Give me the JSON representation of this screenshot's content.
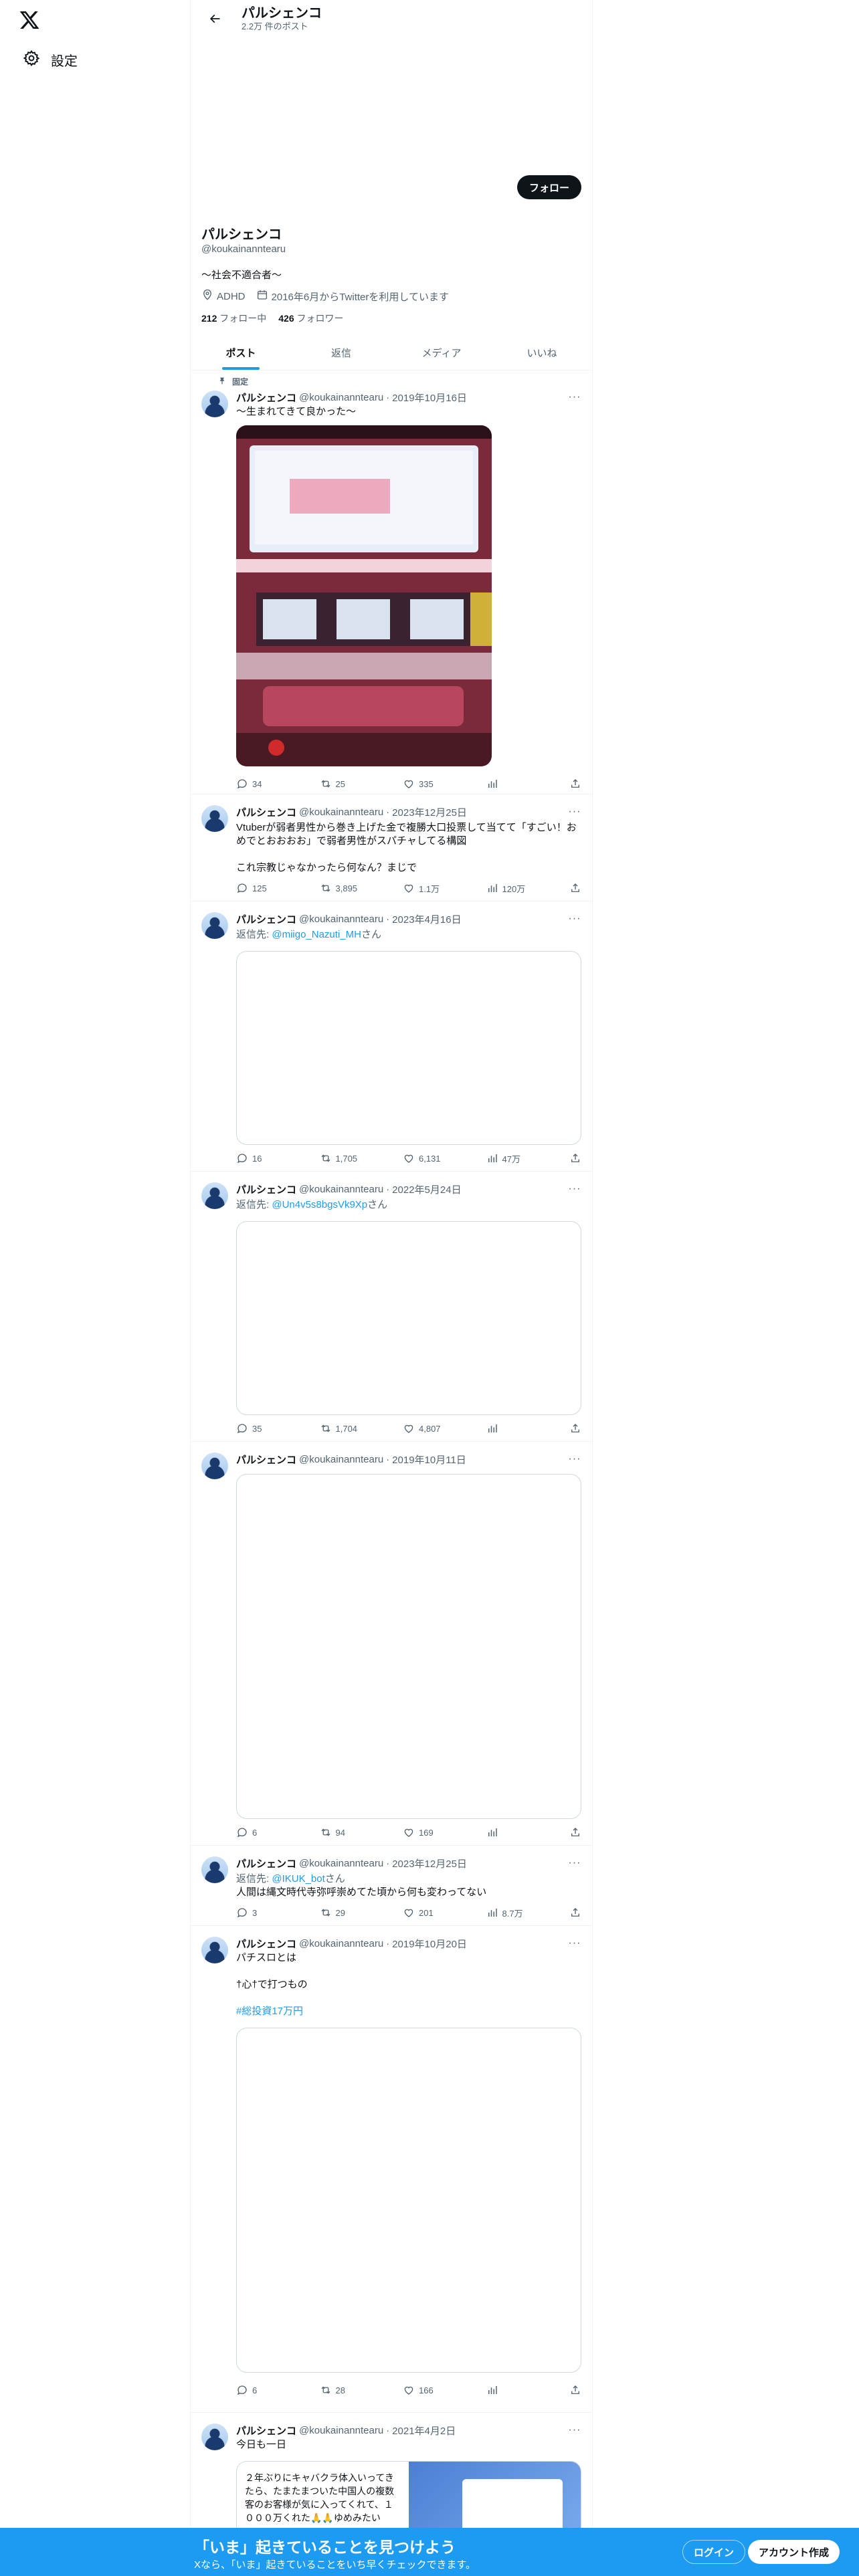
{
  "nav": {
    "settings_label": "設定"
  },
  "header": {
    "name": "パルシェンコ",
    "posts_count": "2.2万 件のポスト"
  },
  "profile": {
    "follow_label": "フォロー",
    "name": "パルシェンコ",
    "handle": "@koukainanntearu",
    "bio": "〜社会不適合者〜",
    "location": "ADHD",
    "joined": "2016年6月からTwitterを利用しています",
    "following_count": "212",
    "following_label": "フォロー中",
    "followers_count": "426",
    "followers_label": "フォロワー"
  },
  "tabs": [
    "ポスト",
    "返信",
    "メディア",
    "いいね"
  ],
  "pinned_label": "固定",
  "posts": [
    {
      "name": "パルシェンコ",
      "handle": "@koukainanntearu",
      "sep": "·",
      "date": "2019年10月16日",
      "text": "〜生まれてきて良かった〜",
      "replies": "34",
      "reposts": "25",
      "likes": "335",
      "views": ""
    },
    {
      "name": "パルシェンコ",
      "handle": "@koukainanntearu",
      "sep": "·",
      "date": "2023年12月25日",
      "text": "Vtuberが弱者男性から巻き上げた金で複勝大口投票して当てて「すごい！おめでとおおおお」で弱者男性がスパチャしてる構図\n\nこれ宗教じゃなかったら何なん？まじで",
      "replies": "125",
      "reposts": "3,895",
      "likes": "1.1万",
      "views": "120万"
    },
    {
      "name": "パルシェンコ",
      "handle": "@koukainanntearu",
      "sep": "·",
      "date": "2023年4月16日",
      "reply_prefix": "返信先: ",
      "reply_to": "@miigo_Nazuti_MH",
      "reply_suffix": "さん",
      "replies": "16",
      "reposts": "1,705",
      "likes": "6,131",
      "views": "47万"
    },
    {
      "name": "パルシェンコ",
      "handle": "@koukainanntearu",
      "sep": "·",
      "date": "2022年5月24日",
      "reply_prefix": "返信先: ",
      "reply_to": "@Un4v5s8bgsVk9Xp",
      "reply_suffix": "さん",
      "replies": "35",
      "reposts": "1,704",
      "likes": "4,807",
      "views": ""
    },
    {
      "name": "パルシェンコ",
      "handle": "@koukainanntearu",
      "sep": "·",
      "date": "2019年10月11日",
      "replies": "6",
      "reposts": "94",
      "likes": "169",
      "views": ""
    },
    {
      "name": "パルシェンコ",
      "handle": "@koukainanntearu",
      "sep": "·",
      "date": "2023年12月25日",
      "reply_prefix": "返信先: ",
      "reply_to": "@IKUK_bot",
      "reply_suffix": "さん",
      "text": "人間は縄文時代寺弥呼崇めてた頃から何も変わってない",
      "replies": "3",
      "reposts": "29",
      "likes": "201",
      "views": "8.7万"
    },
    {
      "name": "パルシェンコ",
      "handle": "@koukainanntearu",
      "sep": "·",
      "date": "2019年10月20日",
      "text": "パチスロとは\n\n†心†で打つもの",
      "hashtag": "#総投資17万円",
      "replies": "6",
      "reposts": "28",
      "likes": "166",
      "views": ""
    },
    {
      "name": "パルシェンコ",
      "handle": "@koukainanntearu",
      "sep": "·",
      "date": "2021年4月2日",
      "text": "今日も一日",
      "image_text": "２年ぶりにキャバクラ体入いってきたら、たまたまついた中国人の複数客のお客様が気に入ってくれて、１０００万くれた🙏🙏ゆめみたい"
    }
  ],
  "bottom": {
    "title": "「いま」起きていることを見つけよう",
    "subtitle": "Xなら、「いま」起きていることをいち早くチェックできます。",
    "login": "ログイン",
    "signup": "アカウント作成"
  }
}
